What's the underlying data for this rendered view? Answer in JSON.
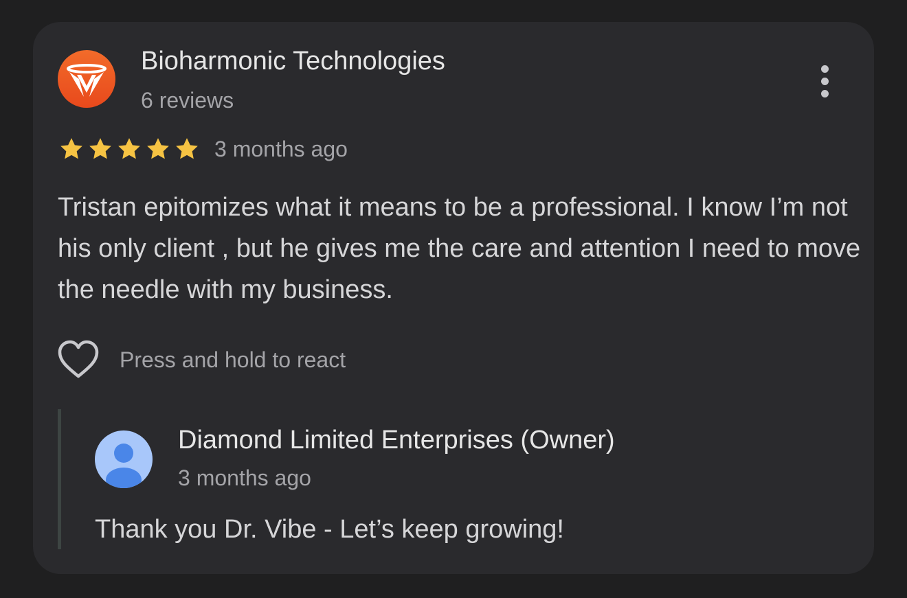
{
  "review": {
    "reviewer_name": "Bioharmonic Technologies",
    "review_count": "6 reviews",
    "avatar_icon": "bioharmonic-logo-icon",
    "rating": 5,
    "rating_max": 5,
    "date": "3 months ago",
    "text": "Tristan epitomizes what it means to be a professional. I know I’m not his only client , but he gives me the care and attention I need to move the needle with my business.",
    "menu_icon": "more-vert-icon"
  },
  "react": {
    "icon": "heart-outline-icon",
    "label": "Press and hold to react"
  },
  "owner_reply": {
    "name": "Diamond Limited Enterprises (Owner)",
    "date": "3 months ago",
    "text": "Thank you Dr. Vibe - Let’s keep growing!",
    "avatar_icon": "default-user-avatar-icon"
  },
  "colors": {
    "background": "#1f1f20",
    "card": "#2a2a2d",
    "star": "#f6c343",
    "logo_orange": "#f05a24",
    "avatar_blue": "#a8c7fa",
    "avatar_person": "#4a86e8"
  }
}
